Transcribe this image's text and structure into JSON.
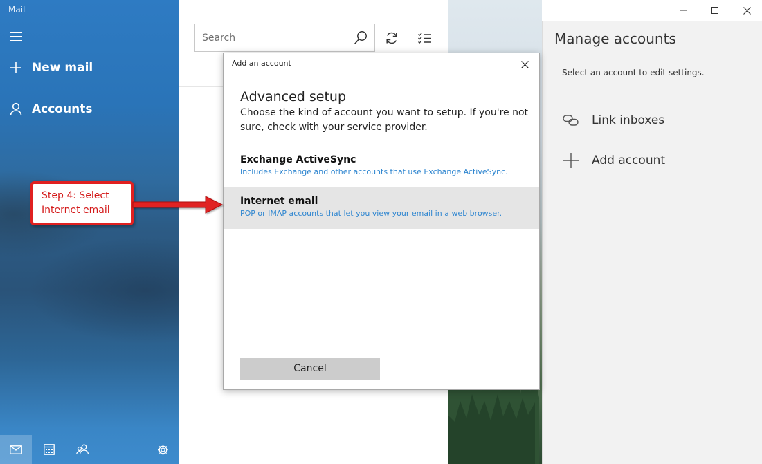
{
  "app": {
    "title": "Mail"
  },
  "nav": {
    "new_mail": "New mail",
    "accounts": "Accounts",
    "bottom": [
      "mail-icon",
      "calendar-icon",
      "people-icon",
      "gear-icon"
    ]
  },
  "list": {
    "search_placeholder": "Search",
    "tools": [
      "sync-icon",
      "select-mode-icon"
    ]
  },
  "manage": {
    "title": "Manage accounts",
    "subtitle": "Select an account to edit settings.",
    "link_inboxes": "Link inboxes",
    "add_account": "Add account"
  },
  "window_controls": [
    "minimize-icon",
    "maximize-icon",
    "close-icon"
  ],
  "dialog": {
    "title": "Add an account",
    "heading": "Advanced setup",
    "description": "Choose the kind of account you want to setup. If you're not sure, check with your service provider.",
    "options": [
      {
        "title": "Exchange ActiveSync",
        "desc": "Includes Exchange and other accounts that use Exchange ActiveSync.",
        "highlighted": false
      },
      {
        "title": "Internet email",
        "desc": "POP or IMAP accounts that let you view your email in a web browser.",
        "highlighted": true
      }
    ],
    "cancel_label": "Cancel"
  },
  "annotation": {
    "text_line1": "Step 4: Select",
    "text_line2": "Internet email",
    "color": "#e02020"
  },
  "colors": {
    "accent": "#2f86d0",
    "nav_blue": "#2e7bc3",
    "highlight_row": "#e5e5e5"
  }
}
